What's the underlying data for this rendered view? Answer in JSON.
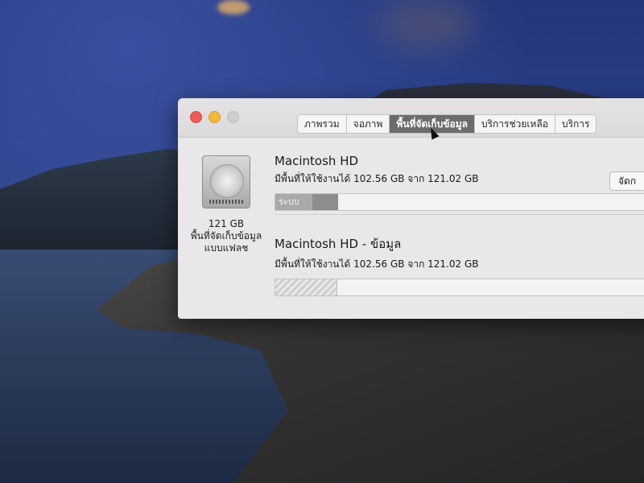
{
  "window": {
    "tabs": [
      {
        "label": "ภาพรวม",
        "active": false
      },
      {
        "label": "จอภาพ",
        "active": false
      },
      {
        "label": "พื้นที่จัดเก็บข้อมูล",
        "active": true
      },
      {
        "label": "บริการช่วยเหลือ",
        "active": false
      },
      {
        "label": "บริการ",
        "active": false
      }
    ]
  },
  "disk": {
    "icon": "hard-drive-icon",
    "capacity": "121 GB",
    "type_line1": "พื้นที่จัดเก็บข้อมูล",
    "type_line2": "แบบแฟลช"
  },
  "volumes": [
    {
      "name": "Macintosh HD",
      "available": "มีพื้นที่ให้ใช้งานได้ 102.56 GB จาก 121.02 GB",
      "segment_label": "ระบบ"
    },
    {
      "name": "Macintosh HD - ข้อมูล",
      "available": "มีพื้นที่ให้ใช้งานได้ 102.56 GB จาก 121.02 GB"
    }
  ],
  "manage_button": "จัดก",
  "colors": {
    "close": "#ee5d56",
    "minimize": "#f2b93a",
    "active_tab": "#6d6b6c"
  }
}
